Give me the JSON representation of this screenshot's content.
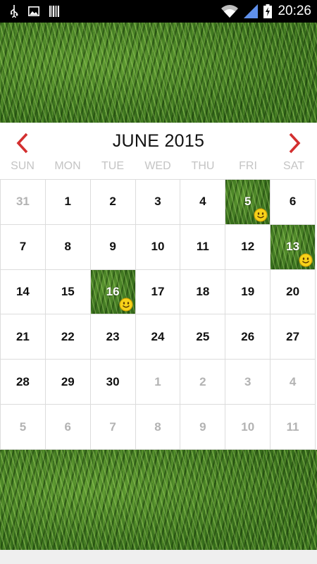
{
  "status_bar": {
    "time": "20:26",
    "left_icons": [
      "usb-icon",
      "image-icon",
      "barcode-icon"
    ],
    "right_icons": [
      "wifi-icon",
      "signal-icon",
      "battery-charging-icon"
    ]
  },
  "calendar": {
    "month_title": "JUNE 2015",
    "prev_icon": "chevron-left-icon",
    "next_icon": "chevron-right-icon",
    "accent_color": "#d32f2f",
    "weekdays": [
      "SUN",
      "MON",
      "TUE",
      "WED",
      "THU",
      "FRI",
      "SAT"
    ],
    "weeks": [
      [
        {
          "day": "31",
          "other": true
        },
        {
          "day": "1"
        },
        {
          "day": "2"
        },
        {
          "day": "3"
        },
        {
          "day": "4"
        },
        {
          "day": "5",
          "photo": true
        },
        {
          "day": "6"
        }
      ],
      [
        {
          "day": "7"
        },
        {
          "day": "8"
        },
        {
          "day": "9"
        },
        {
          "day": "10"
        },
        {
          "day": "11"
        },
        {
          "day": "12"
        },
        {
          "day": "13",
          "photo": true
        }
      ],
      [
        {
          "day": "14"
        },
        {
          "day": "15"
        },
        {
          "day": "16",
          "photo": true
        },
        {
          "day": "17"
        },
        {
          "day": "18"
        },
        {
          "day": "19"
        },
        {
          "day": "20"
        }
      ],
      [
        {
          "day": "21"
        },
        {
          "day": "22"
        },
        {
          "day": "23"
        },
        {
          "day": "24"
        },
        {
          "day": "25"
        },
        {
          "day": "26"
        },
        {
          "day": "27"
        }
      ],
      [
        {
          "day": "28"
        },
        {
          "day": "29"
        },
        {
          "day": "30"
        },
        {
          "day": "1",
          "other": true
        },
        {
          "day": "2",
          "other": true
        },
        {
          "day": "3",
          "other": true
        },
        {
          "day": "4",
          "other": true
        }
      ],
      [
        {
          "day": "5",
          "other": true
        },
        {
          "day": "6",
          "other": true
        },
        {
          "day": "7",
          "other": true
        },
        {
          "day": "8",
          "other": true
        },
        {
          "day": "9",
          "other": true
        },
        {
          "day": "10",
          "other": true
        },
        {
          "day": "11",
          "other": true
        }
      ]
    ]
  }
}
